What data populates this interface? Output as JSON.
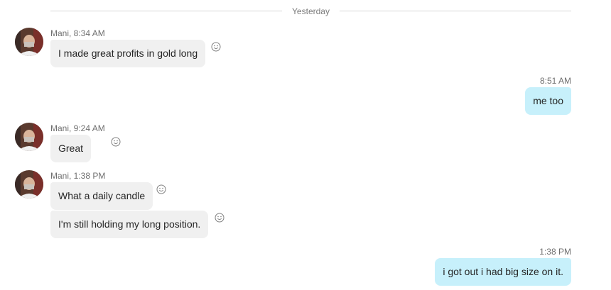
{
  "divider": {
    "label": "Yesterday"
  },
  "messages": [
    {
      "sender": "Mani",
      "time": "8:34 AM",
      "meta": "Mani, 8:34 AM",
      "text": "I made great profits in gold long"
    },
    {
      "time": "8:51 AM",
      "text": "me too"
    },
    {
      "sender": "Mani",
      "time": "9:24 AM",
      "meta": "Mani, 9:24 AM",
      "text": "Great"
    },
    {
      "sender": "Mani",
      "time": "1:38 PM",
      "meta": "Mani, 1:38 PM",
      "text": "What a daily candle"
    },
    {
      "text": "I'm still holding my long position."
    },
    {
      "time": "1:38 PM",
      "text": "i got out i had big size on it."
    }
  ],
  "icons": {
    "avatar": "user-avatar-photo",
    "reaction": "smiley-face-icon"
  },
  "colors": {
    "incoming_bubble": "#f0f0f0",
    "outgoing_bubble": "#c7f0fb",
    "meta_text": "#6f6f6f",
    "divider_line": "#d6d6d6"
  }
}
